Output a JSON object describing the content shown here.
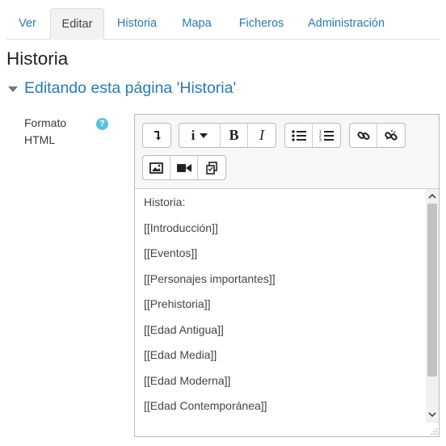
{
  "tabs": [
    "Ver",
    "Editar",
    "Historia",
    "Mapa",
    "Ficheros",
    "Administración"
  ],
  "page_title": "Historia",
  "section_title": "Editando esta página 'Historia'",
  "field": {
    "label_line1": "Formato",
    "label_line2": "HTML",
    "help_glyph": "?"
  },
  "editor_lines": [
    "Historia:",
    "[[Introducción]]",
    "[[Eventos]]",
    "[[Personajes importantes]]",
    "[[Prehistoria]]",
    "[[Edad Antigua]]",
    "[[Edad Media]]",
    "[[Edad Moderna]]",
    "[[Edad Contemporánea]]"
  ],
  "toolbar_icons": [
    "toggle-toolbar-icon",
    "paragraph-style-icon",
    "bold-icon",
    "italic-icon",
    "unordered-list-icon",
    "ordered-list-icon",
    "link-icon",
    "unlink-icon",
    "image-icon",
    "media-icon",
    "manage-files-icon"
  ],
  "colors": {
    "link": "#2a7ab3",
    "help": "#5bc0de",
    "active_tab_bg": "#f2f2f2"
  }
}
